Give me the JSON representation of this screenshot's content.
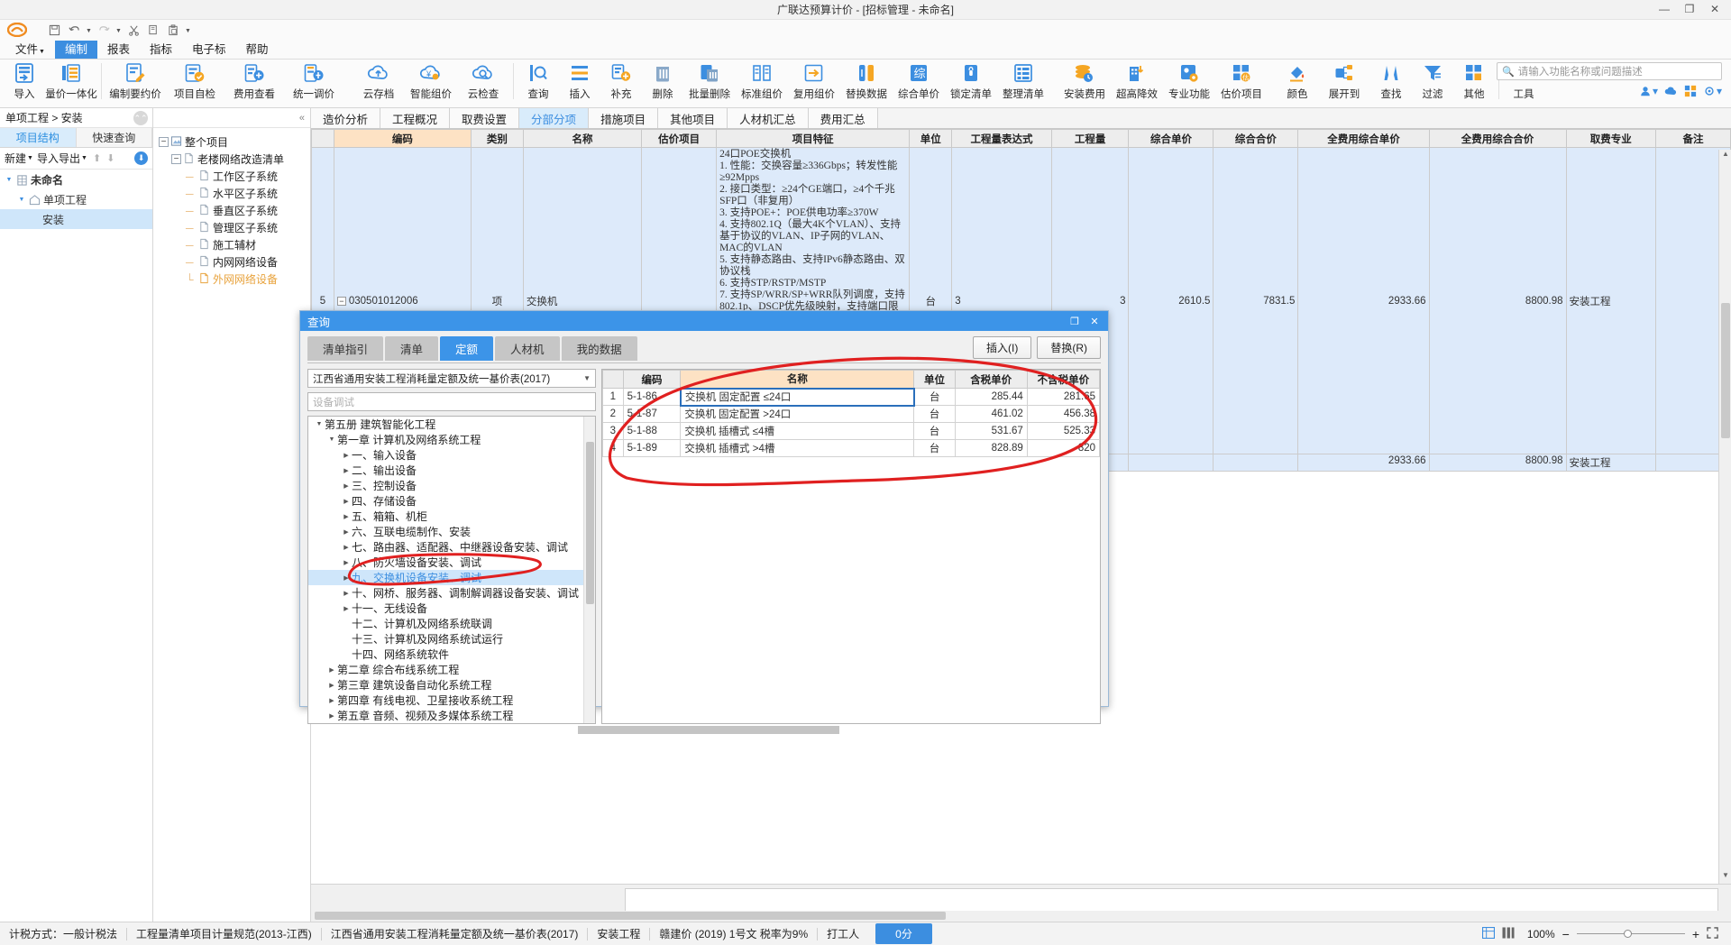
{
  "window": {
    "title": "广联达预算计价 - [招标管理 - 未命名]",
    "min": "—",
    "max": "□",
    "close": "✕",
    "restore": "❐"
  },
  "quick_access": {
    "logo": "cloud-logo",
    "items": [
      {
        "name": "save-icon",
        "glyph": "🖫"
      },
      {
        "name": "undo-icon",
        "glyph": "↺"
      },
      {
        "name": "undo-dropdown-caret",
        "glyph": "▾"
      },
      {
        "name": "redo-icon",
        "glyph": "↻"
      },
      {
        "name": "redo-dropdown-caret",
        "glyph": "▾"
      },
      {
        "name": "cut-icon",
        "glyph": "✂"
      },
      {
        "name": "copy-icon",
        "glyph": "🗐"
      },
      {
        "name": "paste-icon",
        "glyph": "📋"
      },
      {
        "name": "more-caret",
        "glyph": "▾"
      }
    ]
  },
  "menubar": {
    "items": [
      {
        "label": "文件",
        "caret": "▾",
        "active": false
      },
      {
        "label": "编制",
        "caret": "",
        "active": true
      },
      {
        "label": "报表",
        "caret": "",
        "active": false
      },
      {
        "label": "指标",
        "caret": "",
        "active": false
      },
      {
        "label": "电子标",
        "caret": "",
        "active": false
      },
      {
        "label": "帮助",
        "caret": "",
        "active": false
      }
    ]
  },
  "ribbon": {
    "items": [
      {
        "label": "导入",
        "icon": "import-icon",
        "caret": "▾"
      },
      {
        "label": "量价一体化",
        "icon": "quantity-price-icon",
        "caret": ""
      },
      {
        "label": "编制要约价",
        "icon": "edit-offer-price-icon",
        "caret": ""
      },
      {
        "label": "项目自检",
        "icon": "project-check-icon",
        "caret": ""
      },
      {
        "label": "费用查看",
        "icon": "fee-view-icon",
        "caret": ""
      },
      {
        "label": "统一调价",
        "icon": "unified-price-icon",
        "caret": "▾"
      },
      {
        "label": "云存档",
        "icon": "cloud-archive-icon",
        "caret": ""
      },
      {
        "label": "智能组价",
        "icon": "smart-pricing-icon",
        "caret": ""
      },
      {
        "label": "云检查",
        "icon": "cloud-check-icon",
        "caret": ""
      },
      {
        "label": "查询",
        "icon": "search-icon",
        "caret": "▾"
      },
      {
        "label": "插入",
        "icon": "insert-icon",
        "caret": "▾"
      },
      {
        "label": "补充",
        "icon": "supplement-icon",
        "caret": "▾"
      },
      {
        "label": "删除",
        "icon": "delete-icon",
        "caret": ""
      },
      {
        "label": "批量删除",
        "icon": "batch-delete-icon",
        "caret": ""
      },
      {
        "label": "标准组价",
        "icon": "standard-price-icon",
        "caret": ""
      },
      {
        "label": "复用组价",
        "icon": "reuse-price-icon",
        "caret": ""
      },
      {
        "label": "替换数据",
        "icon": "replace-data-icon",
        "caret": ""
      },
      {
        "label": "综合单价",
        "icon": "comprehensive-price-icon",
        "caret": ""
      },
      {
        "label": "锁定清单",
        "icon": "lock-list-icon",
        "caret": ""
      },
      {
        "label": "整理清单",
        "icon": "organize-list-icon",
        "caret": ""
      },
      {
        "label": "安装费用",
        "icon": "install-fee-icon",
        "caret": ""
      },
      {
        "label": "超高降效",
        "icon": "height-efficiency-icon",
        "caret": ""
      },
      {
        "label": "专业功能",
        "icon": "pro-function-icon",
        "caret": "▾"
      },
      {
        "label": "估价项目",
        "icon": "estimate-project-icon",
        "caret": ""
      },
      {
        "label": "颜色",
        "icon": "color-icon",
        "caret": ""
      },
      {
        "label": "展开到",
        "icon": "expand-to-icon",
        "caret": "▾"
      },
      {
        "label": "查找",
        "icon": "find-icon",
        "caret": ""
      },
      {
        "label": "过滤",
        "icon": "filter-icon",
        "caret": ""
      },
      {
        "label": "其他",
        "icon": "other-icon",
        "caret": "▾"
      },
      {
        "label": "工具",
        "icon": "tools-icon",
        "caret": "▾"
      }
    ],
    "search_placeholder": "请输入功能名称或问题描述"
  },
  "left_panel": {
    "breadcrumb": "单项工程 > 安装",
    "collapse_icon": "chevron-up-icon",
    "tabs": [
      {
        "label": "项目结构",
        "active": true
      },
      {
        "label": "快速查询",
        "active": false
      }
    ],
    "toolbar": [
      {
        "label": "新建",
        "caret": "▾"
      },
      {
        "label": "导入导出",
        "caret": "▾"
      }
    ],
    "arrow_up": "↑",
    "arrow_down": "↓",
    "download_icon": "download-icon",
    "tree": [
      {
        "label": "未命名",
        "icon": "building-icon",
        "tri": "▼",
        "indent": 0,
        "bold": true,
        "selected": false
      },
      {
        "label": "单项工程",
        "icon": "home-icon",
        "tri": "▼",
        "indent": 1,
        "bold": false,
        "selected": false
      },
      {
        "label": "安装",
        "icon": "",
        "tri": "",
        "indent": 2,
        "bold": false,
        "selected": true
      }
    ]
  },
  "project_tree": {
    "nodes": [
      {
        "label": "整个项目",
        "level": 0,
        "expander": "−",
        "icon": "project-icon",
        "highlight": false
      },
      {
        "label": "老楼网络改造清单",
        "level": 1,
        "expander": "−",
        "icon": "file-icon",
        "highlight": false
      },
      {
        "label": "工作区子系统",
        "level": 2,
        "expander": "",
        "icon": "file-icon",
        "highlight": false
      },
      {
        "label": "水平区子系统",
        "level": 2,
        "expander": "",
        "icon": "file-icon",
        "highlight": false
      },
      {
        "label": "垂直区子系统",
        "level": 2,
        "expander": "",
        "icon": "file-icon",
        "highlight": false
      },
      {
        "label": "管理区子系统",
        "level": 2,
        "expander": "",
        "icon": "file-icon",
        "highlight": false
      },
      {
        "label": "施工辅材",
        "level": 2,
        "expander": "",
        "icon": "file-icon",
        "highlight": false
      },
      {
        "label": "内网网络设备",
        "level": 2,
        "expander": "",
        "icon": "file-icon",
        "highlight": false
      },
      {
        "label": "外网网络设备",
        "level": 2,
        "expander": "",
        "icon": "file-icon",
        "highlight": true
      }
    ]
  },
  "main_tabs": [
    {
      "label": "造价分析",
      "active": false
    },
    {
      "label": "工程概况",
      "active": false
    },
    {
      "label": "取费设置",
      "active": false
    },
    {
      "label": "分部分项",
      "active": true
    },
    {
      "label": "措施项目",
      "active": false
    },
    {
      "label": "其他项目",
      "active": false
    },
    {
      "label": "人材机汇总",
      "active": false
    },
    {
      "label": "费用汇总",
      "active": false
    }
  ],
  "grid": {
    "headers": [
      "编码",
      "类别",
      "名称",
      "估价项目",
      "项目特征",
      "单位",
      "工程量表达式",
      "工程量",
      "综合单价",
      "综合合价",
      "全费用综合单价",
      "全费用综合合价",
      "取费专业",
      "备注"
    ],
    "row_number": "5",
    "row": {
      "code": "030501012006",
      "category": "项",
      "name": "交换机",
      "estimate": "",
      "feature": "24口POE交换机\n1. 性能：交换容量≥336Gbps；转发性能≥92Mpps\n2. 接口类型：≥24个GE端口，≥4个千兆SFP口（非复用）\n3. 支持POE+：POE供电功率≥370W\n4. 支持802.1Q（最大4K个VLAN）、支持基于协议的VLAN、IP子网的VLAN、MAC的VLAN\n5. 支持静态路由、支持IPv6静态路由、双协议栈\n6. 支持STP/RSTP/MSTP\n7. 支持SP/WRR/SP+WRR队列调度，支持802.1p、DSCP优先级映射，支持端口限速802.1p、DSCP优先级映射；\n8. 支持二层、三层、四层ACL、支持IPv4、IPv6 ACL、支持VLAN、",
      "unit": "台",
      "qty_expr": "3",
      "qty": "3",
      "unit_price": "2610.5",
      "total_price": "7831.5",
      "full_unit_price": "2933.66",
      "full_total_price": "8800.98",
      "profession": "安装工程",
      "remark": ""
    },
    "row2": {
      "full_unit_price": "2933.66",
      "full_total_price": "8800.98",
      "profession": "安装工程"
    }
  },
  "dialog": {
    "title": "查询",
    "minimize": "❐",
    "close": "✕",
    "tabs": [
      {
        "label": "清单指引",
        "active": false
      },
      {
        "label": "清单",
        "active": false
      },
      {
        "label": "定额",
        "active": true
      },
      {
        "label": "人材机",
        "active": false
      },
      {
        "label": "我的数据",
        "active": false
      }
    ],
    "buttons": [
      {
        "label": "插入(I)"
      },
      {
        "label": "替换(R)"
      }
    ],
    "standard_select": "江西省通用安装工程消耗量定额及统一基价表(2017)",
    "search_placeholder": "设备调试",
    "tree": [
      {
        "label": "第五册 建筑智能化工程",
        "level": 0,
        "tri": "▼",
        "selected": false
      },
      {
        "label": "第一章 计算机及网络系统工程",
        "level": 1,
        "tri": "▼",
        "selected": false
      },
      {
        "label": "一、输入设备",
        "level": 2,
        "tri": "▶",
        "selected": false
      },
      {
        "label": "二、输出设备",
        "level": 2,
        "tri": "▶",
        "selected": false
      },
      {
        "label": "三、控制设备",
        "level": 2,
        "tri": "▶",
        "selected": false
      },
      {
        "label": "四、存储设备",
        "level": 2,
        "tri": "▶",
        "selected": false
      },
      {
        "label": "五、箱箱、机柜",
        "level": 2,
        "tri": "▶",
        "selected": false
      },
      {
        "label": "六、互联电缆制作、安装",
        "level": 2,
        "tri": "▶",
        "selected": false
      },
      {
        "label": "七、路由器、适配器、中继器设备安装、调试",
        "level": 2,
        "tri": "▶",
        "selected": false
      },
      {
        "label": "八、防火墙设备安装、调试",
        "level": 2,
        "tri": "▶",
        "selected": false
      },
      {
        "label": "九、交换机设备安装、调试",
        "level": 2,
        "tri": "▶",
        "selected": true
      },
      {
        "label": "十、网桥、服务器、调制解调器设备安装、调试",
        "level": 2,
        "tri": "▶",
        "selected": false
      },
      {
        "label": "十一、无线设备",
        "level": 2,
        "tri": "▶",
        "selected": false
      },
      {
        "label": "十二、计算机及网络系统联调",
        "level": 2,
        "tri": "",
        "selected": false
      },
      {
        "label": "十三、计算机及网络系统试运行",
        "level": 2,
        "tri": "",
        "selected": false
      },
      {
        "label": "十四、网络系统软件",
        "level": 2,
        "tri": "",
        "selected": false
      },
      {
        "label": "第二章 综合布线系统工程",
        "level": 1,
        "tri": "▶",
        "selected": false
      },
      {
        "label": "第三章 建筑设备自动化系统工程",
        "level": 1,
        "tri": "▶",
        "selected": false
      },
      {
        "label": "第四章 有线电视、卫星接收系统工程",
        "level": 1,
        "tri": "▶",
        "selected": false
      },
      {
        "label": "第五章 音频、视频及多媒体系统工程",
        "level": 1,
        "tri": "▶",
        "selected": false
      }
    ],
    "result_headers": [
      "",
      "编码",
      "名称",
      "单位",
      "含税单价",
      "不含税单价"
    ],
    "results": [
      {
        "no": "1",
        "code": "5-1-86",
        "name": "交换机 固定配置 ≤24口",
        "unit": "台",
        "taxed": "285.44",
        "untaxed": "281.65",
        "selected": true
      },
      {
        "no": "2",
        "code": "5-1-87",
        "name": "交换机 固定配置 >24口",
        "unit": "台",
        "taxed": "461.02",
        "untaxed": "456.38",
        "selected": false
      },
      {
        "no": "3",
        "code": "5-1-88",
        "name": "交换机 插槽式 ≤4槽",
        "unit": "台",
        "taxed": "531.67",
        "untaxed": "525.33",
        "selected": false
      },
      {
        "no": "4",
        "code": "5-1-89",
        "name": "交换机 插槽式 >4槽",
        "unit": "台",
        "taxed": "828.89",
        "untaxed": "820",
        "selected": false
      }
    ]
  },
  "statusbar": {
    "items": [
      "计税方式：一般计税法",
      "工程量清单项目计量规范(2013-江西)",
      "江西省通用安装工程消耗量定额及统一基价表(2017)",
      "安装工程",
      "赣建价 (2019) 1号文 税率为9%",
      "打工人"
    ],
    "badge": "0分",
    "zoom": "100%",
    "icons": [
      "grid-view-icon",
      "split-view-icon"
    ],
    "zoom_minus": "−",
    "zoom_plus": "+",
    "fullscreen_icon": "fullscreen-icon"
  },
  "annotations": {
    "color": "#e02020",
    "shapes": [
      "ellipse-around-results",
      "ellipse-around-tree-item"
    ]
  }
}
